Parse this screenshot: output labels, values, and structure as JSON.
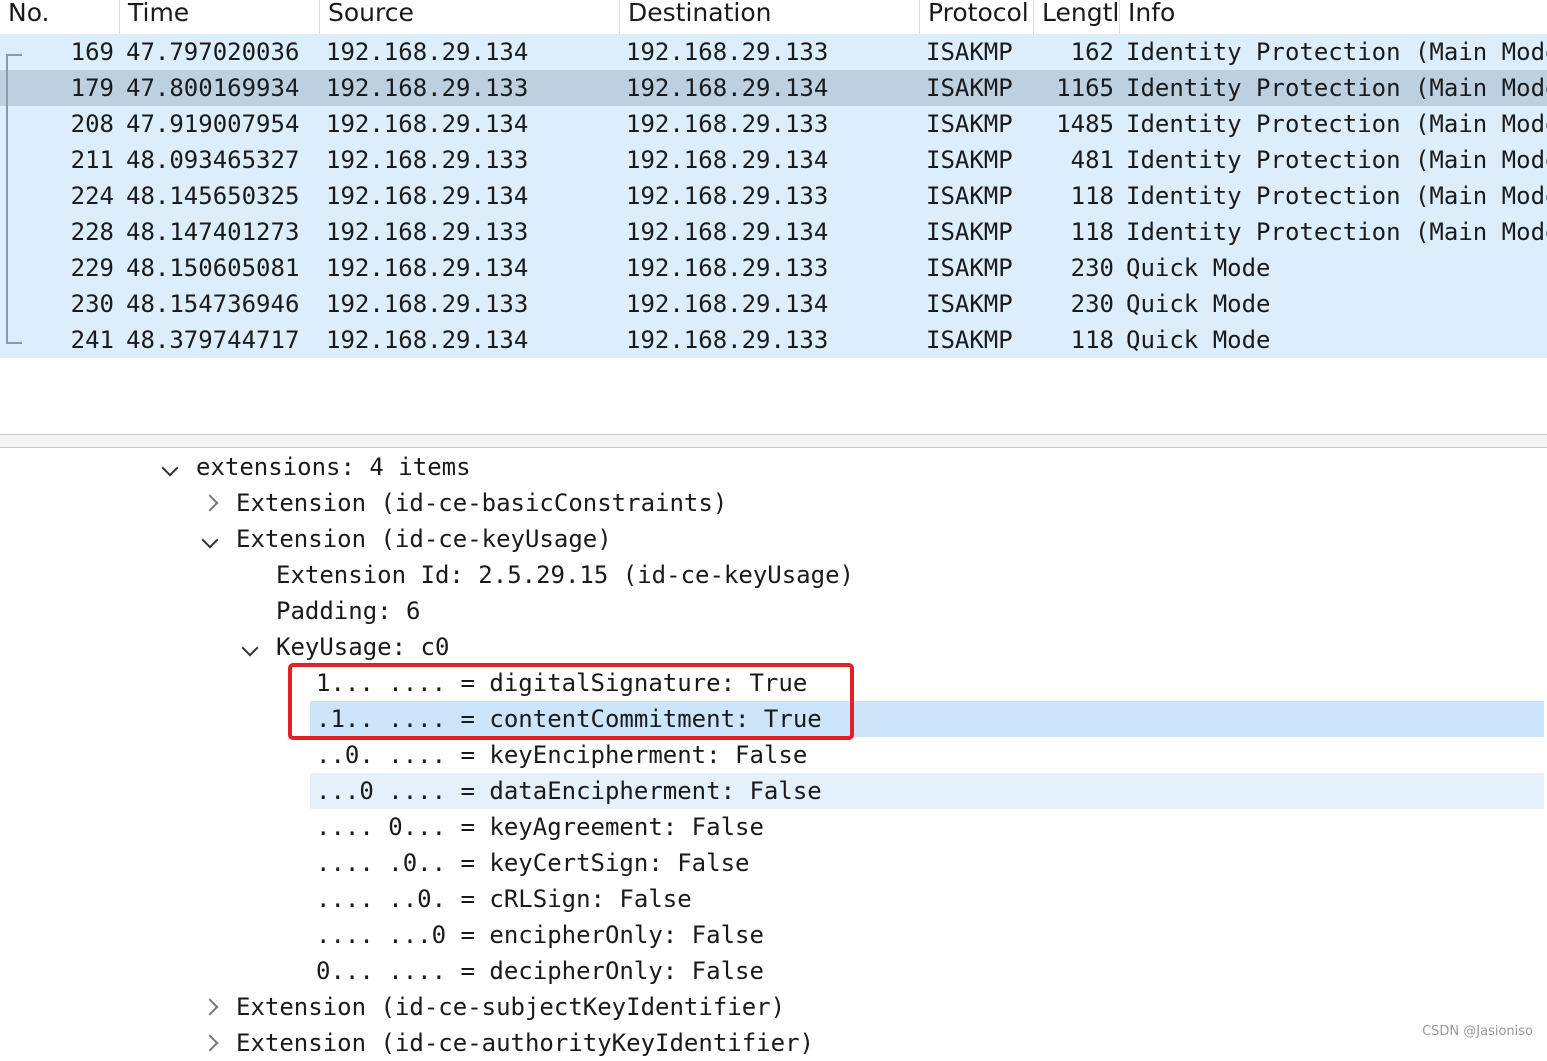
{
  "packet_list": {
    "columns": [
      "No.",
      "Time",
      "Source",
      "Destination",
      "Protocol",
      "Lengtl",
      "Info"
    ],
    "rows": [
      {
        "no": "169",
        "time": "47.797020036",
        "src": "192.168.29.134",
        "dst": "192.168.29.133",
        "proto": "ISAKMP",
        "len": "162",
        "info": "Identity Protection (Main Mode"
      },
      {
        "no": "179",
        "time": "47.800169934",
        "src": "192.168.29.133",
        "dst": "192.168.29.134",
        "proto": "ISAKMP",
        "len": "1165",
        "info": "Identity Protection (Main Mode"
      },
      {
        "no": "208",
        "time": "47.919007954",
        "src": "192.168.29.134",
        "dst": "192.168.29.133",
        "proto": "ISAKMP",
        "len": "1485",
        "info": "Identity Protection (Main Mode"
      },
      {
        "no": "211",
        "time": "48.093465327",
        "src": "192.168.29.133",
        "dst": "192.168.29.134",
        "proto": "ISAKMP",
        "len": "481",
        "info": "Identity Protection (Main Mode"
      },
      {
        "no": "224",
        "time": "48.145650325",
        "src": "192.168.29.134",
        "dst": "192.168.29.133",
        "proto": "ISAKMP",
        "len": "118",
        "info": "Identity Protection (Main Mode"
      },
      {
        "no": "228",
        "time": "48.147401273",
        "src": "192.168.29.133",
        "dst": "192.168.29.134",
        "proto": "ISAKMP",
        "len": "118",
        "info": "Identity Protection (Main Mode"
      },
      {
        "no": "229",
        "time": "48.150605081",
        "src": "192.168.29.134",
        "dst": "192.168.29.133",
        "proto": "ISAKMP",
        "len": "230",
        "info": "Quick Mode"
      },
      {
        "no": "230",
        "time": "48.154736946",
        "src": "192.168.29.133",
        "dst": "192.168.29.134",
        "proto": "ISAKMP",
        "len": "230",
        "info": "Quick Mode"
      },
      {
        "no": "241",
        "time": "48.379744717",
        "src": "192.168.29.134",
        "dst": "192.168.29.133",
        "proto": "ISAKMP",
        "len": "118",
        "info": "Quick Mode"
      }
    ],
    "selected_no": "179"
  },
  "detail_tree": [
    {
      "text": "extensions: 4 items",
      "arrow": "down",
      "depth": 0
    },
    {
      "text": "Extension (id-ce-basicConstraints)",
      "arrow": "right",
      "depth": 1
    },
    {
      "text": "Extension (id-ce-keyUsage)",
      "arrow": "down",
      "depth": 1
    },
    {
      "text": "Extension Id: 2.5.29.15 (id-ce-keyUsage)",
      "arrow": "none",
      "depth": 2
    },
    {
      "text": "Padding: 6",
      "arrow": "none",
      "depth": 2
    },
    {
      "text": "KeyUsage: c0",
      "arrow": "down",
      "depth": 2
    },
    {
      "text": "1... .... = digitalSignature: True",
      "arrow": "none",
      "depth": 3
    },
    {
      "text": ".1.. .... = contentCommitment: True",
      "arrow": "none",
      "depth": 3,
      "highlight": "strong"
    },
    {
      "text": "..0. .... = keyEncipherment: False",
      "arrow": "none",
      "depth": 3
    },
    {
      "text": "...0 .... = dataEncipherment: False",
      "arrow": "none",
      "depth": 3,
      "highlight": "light"
    },
    {
      "text": ".... 0... = keyAgreement: False",
      "arrow": "none",
      "depth": 3
    },
    {
      "text": ".... .0.. = keyCertSign: False",
      "arrow": "none",
      "depth": 3
    },
    {
      "text": ".... ..0. = cRLSign: False",
      "arrow": "none",
      "depth": 3
    },
    {
      "text": ".... ...0 = encipherOnly: False",
      "arrow": "none",
      "depth": 3
    },
    {
      "text": "0... .... = decipherOnly: False",
      "arrow": "none",
      "depth": 3
    },
    {
      "text": "Extension (id-ce-subjectKeyIdentifier)",
      "arrow": "right",
      "depth": 1
    },
    {
      "text": "Extension (id-ce-authorityKeyIdentifier)",
      "arrow": "right",
      "depth": 1
    }
  ],
  "watermark": "CSDN @Jasioniso",
  "colors": {
    "row_bg": "#dcedfc",
    "selected_row_bg": "#bdd0e0",
    "highlight_strong": "#cce5fb",
    "highlight_light": "#e4f1fc",
    "annotation_box": "#e0202b"
  }
}
